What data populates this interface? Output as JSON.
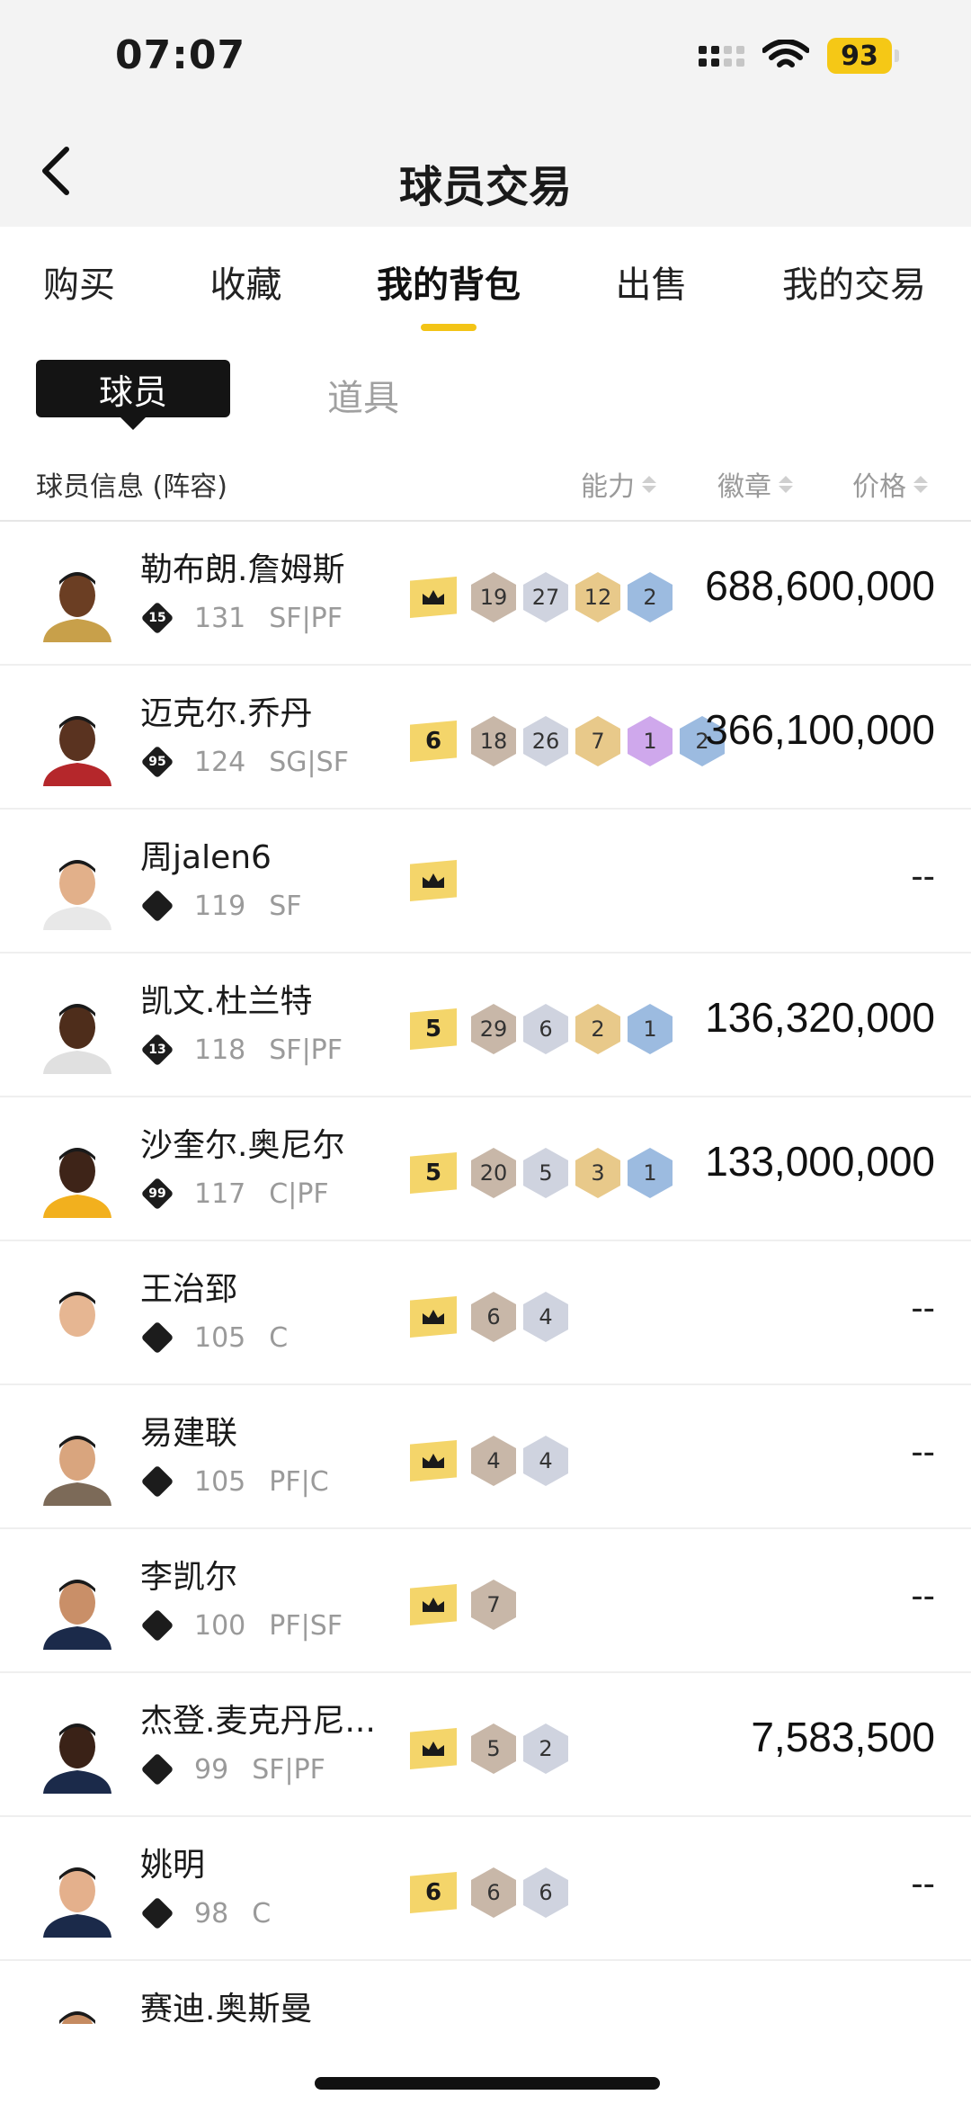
{
  "status": {
    "time": "07:07",
    "battery": "93"
  },
  "header": {
    "title": "球员交易"
  },
  "tabs": [
    {
      "label": "购买"
    },
    {
      "label": "收藏"
    },
    {
      "label": "我的背包"
    },
    {
      "label": "出售"
    },
    {
      "label": "我的交易"
    }
  ],
  "segment": {
    "active": "球员",
    "other": "道具"
  },
  "columns": {
    "info": "球员信息 (阵容)",
    "ability": "能力",
    "badge": "徽章",
    "price": "价格"
  },
  "players": [
    {
      "name": "勒布朗.詹姆斯",
      "jersey": "15",
      "ovr": "131",
      "pos": "SF|PF",
      "rank": "crown",
      "badges": [
        [
          "19",
          "bronze"
        ],
        [
          "27",
          "silver"
        ],
        [
          "12",
          "gold"
        ],
        [
          "2",
          "blue"
        ]
      ],
      "price": "688,600,000"
    },
    {
      "name": "迈克尔.乔丹",
      "jersey": "95",
      "ovr": "124",
      "pos": "SG|SF",
      "rank": "6",
      "badges": [
        [
          "18",
          "bronze"
        ],
        [
          "26",
          "silver"
        ],
        [
          "7",
          "gold"
        ],
        [
          "1",
          "purple"
        ],
        [
          "2",
          "blue"
        ]
      ],
      "price": "366,100,000"
    },
    {
      "name": "周jalen6",
      "jersey": "",
      "ovr": "119",
      "pos": "SF",
      "rank": "crown",
      "badges": [],
      "price": "--"
    },
    {
      "name": "凯文.杜兰特",
      "jersey": "13",
      "ovr": "118",
      "pos": "SF|PF",
      "rank": "5",
      "badges": [
        [
          "29",
          "bronze"
        ],
        [
          "6",
          "silver"
        ],
        [
          "2",
          "gold"
        ],
        [
          "1",
          "blue"
        ]
      ],
      "price": "136,320,000"
    },
    {
      "name": "沙奎尔.奥尼尔",
      "jersey": "99",
      "ovr": "117",
      "pos": "C|PF",
      "rank": "5",
      "badges": [
        [
          "20",
          "bronze"
        ],
        [
          "5",
          "silver"
        ],
        [
          "3",
          "gold"
        ],
        [
          "1",
          "blue"
        ]
      ],
      "price": "133,000,000"
    },
    {
      "name": "王治郅",
      "jersey": "",
      "ovr": "105",
      "pos": "C",
      "rank": "crown",
      "badges": [
        [
          "6",
          "bronze"
        ],
        [
          "4",
          "silver"
        ]
      ],
      "price": "--"
    },
    {
      "name": "易建联",
      "jersey": "",
      "ovr": "105",
      "pos": "PF|C",
      "rank": "crown",
      "badges": [
        [
          "4",
          "bronze"
        ],
        [
          "4",
          "silver"
        ]
      ],
      "price": "--"
    },
    {
      "name": "李凯尔",
      "jersey": "",
      "ovr": "100",
      "pos": "PF|SF",
      "rank": "crown",
      "badges": [
        [
          "7",
          "bronze"
        ]
      ],
      "price": "--"
    },
    {
      "name": "杰登.麦克丹尼...",
      "jersey": "",
      "ovr": "99",
      "pos": "SF|PF",
      "rank": "crown",
      "badges": [
        [
          "5",
          "bronze"
        ],
        [
          "2",
          "silver"
        ]
      ],
      "price": "7,583,500"
    },
    {
      "name": "姚明",
      "jersey": "",
      "ovr": "98",
      "pos": "C",
      "rank": "6",
      "badges": [
        [
          "6",
          "bronze"
        ],
        [
          "6",
          "silver"
        ]
      ],
      "price": "--"
    },
    {
      "name": "赛迪.奥斯曼",
      "jersey": "",
      "ovr": "",
      "pos": "",
      "rank": "",
      "badges": [],
      "price": ""
    }
  ],
  "colors": {
    "accent": "#f3c416",
    "rank_bg": "#f4d56a"
  }
}
